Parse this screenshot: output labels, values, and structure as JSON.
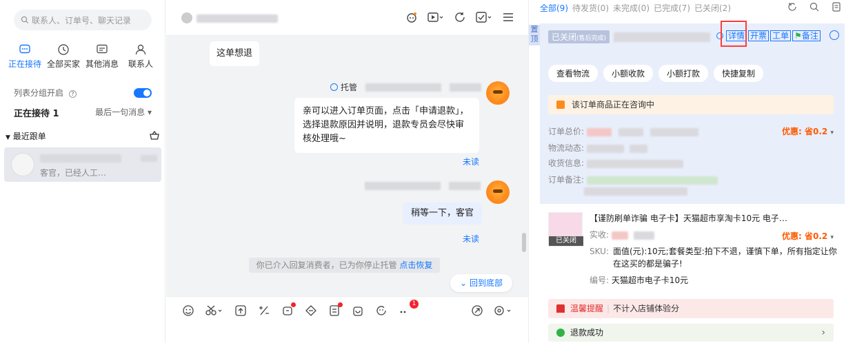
{
  "left": {
    "search_placeholder": "联系人、订单号、聊天记录",
    "tabs": [
      {
        "label": "正在接待",
        "icon": "chat-bubble-icon"
      },
      {
        "label": "全部买家",
        "icon": "clock-icon"
      },
      {
        "label": "其他消息",
        "icon": "message-icon"
      },
      {
        "label": "联系人",
        "icon": "person-icon"
      }
    ],
    "group_label": "列表分组开启",
    "receiving_title": "正在接待 1",
    "sort_label": "最后一句消息",
    "recent_label": "最近跟单",
    "conversation_preview": "客官，已经人工…"
  },
  "chat": {
    "messages": {
      "customer_msg": "这单想退",
      "bot_tag": "托管",
      "bot_reply": "亲可以进入订单页面，点击「申请退款」，选择退款原因并说明，退款专员会尽快审核处理哦~",
      "unread_1": "未读",
      "agent_reply": "稍等一下，客官",
      "unread_2": "未读"
    },
    "system_msg": "你已介入回复消费者，已为你停止托管 ",
    "system_link": "点击恢复",
    "back_to_bottom": "回到底部",
    "toolbar_badge": "1"
  },
  "right": {
    "filters": [
      "全部(9)",
      "待发货(0)",
      "未完成(0)",
      "已完成(7)",
      "已关闭(2)"
    ],
    "pin_label": "置顶",
    "status_chip": "已关闭",
    "status_sub": "(售后完成)",
    "actions": [
      "详情",
      "开票",
      "工单",
      "备注"
    ],
    "buttons": [
      "查看物流",
      "小额收款",
      "小额打款",
      "快捷复制"
    ],
    "notice": "该订单商品正在咨询中",
    "fields": [
      "订单总价:",
      "物流动态:",
      "收货信息:",
      "订单备注:"
    ],
    "promo": "优惠: 省0.2",
    "product": {
      "title": "【谨防刷单诈骗 电子卡】天猫超市享淘卡10元 电子…",
      "status": "已关闭",
      "paid_label": "实收:",
      "promo": "优惠: 省0.2",
      "sku_label": "SKU:",
      "sku_value_1": "面值(元):10元;套餐类型:拍下不退，谨慎下单，所有指定让你",
      "sku_value_2": "在这买的都是骗子!",
      "code_label": "编号:",
      "code_value": "天猫超市电子卡10元"
    },
    "warn_title": "温馨提醒",
    "warn_text": "不计入店铺体验分",
    "success_text": "退款成功"
  }
}
